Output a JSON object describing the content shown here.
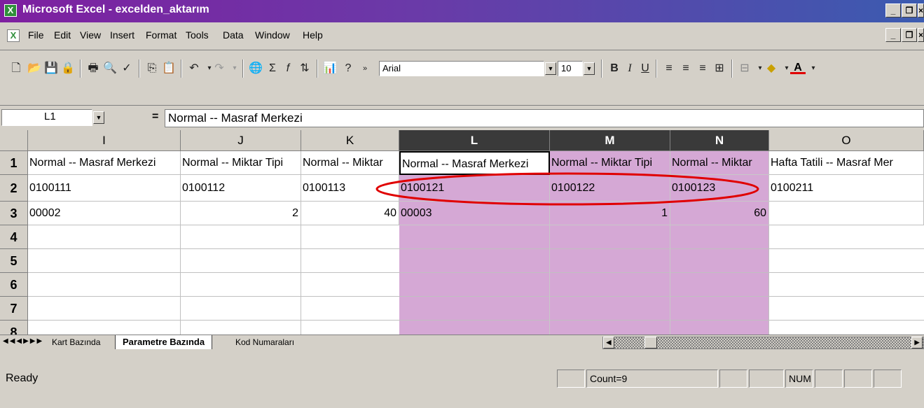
{
  "window": {
    "title": "Microsoft Excel - excelden_aktarım"
  },
  "menu": [
    "File",
    "Edit",
    "View",
    "Insert",
    "Format",
    "Tools",
    "Data",
    "Window",
    "Help"
  ],
  "toolbar": {
    "font": "Arial",
    "size": "10"
  },
  "formula": {
    "name_box": "L1",
    "equals": "=",
    "content": "Normal -- Masraf Merkezi"
  },
  "columns": [
    "I",
    "J",
    "K",
    "L",
    "M",
    "N",
    "O"
  ],
  "rows": [
    "1",
    "2",
    "3",
    "4",
    "5",
    "6",
    "7",
    "8"
  ],
  "cells": {
    "r1": [
      "Normal -- Masraf Merkezi",
      "Normal -- Miktar Tipi",
      "Normal -- Miktar",
      "Normal -- Masraf Merkezi",
      "Normal -- Miktar Tipi",
      "Normal -- Miktar",
      "Hafta Tatili -- Masraf Mer"
    ],
    "r2": [
      "0100111",
      "0100112",
      "0100113",
      "0100121",
      "0100122",
      "0100123",
      "0100211"
    ],
    "r3": [
      "00002",
      "2",
      "40",
      "00003",
      "1",
      "60",
      ""
    ]
  },
  "sheets": [
    "Kart Bazında",
    "Parametre Bazında",
    "Kod Numaraları"
  ],
  "status": {
    "ready": "Ready",
    "count": "Count=9",
    "num": "NUM"
  },
  "colors": {
    "selection": "#d5a8d5",
    "highlight_ring": "#e00000"
  }
}
